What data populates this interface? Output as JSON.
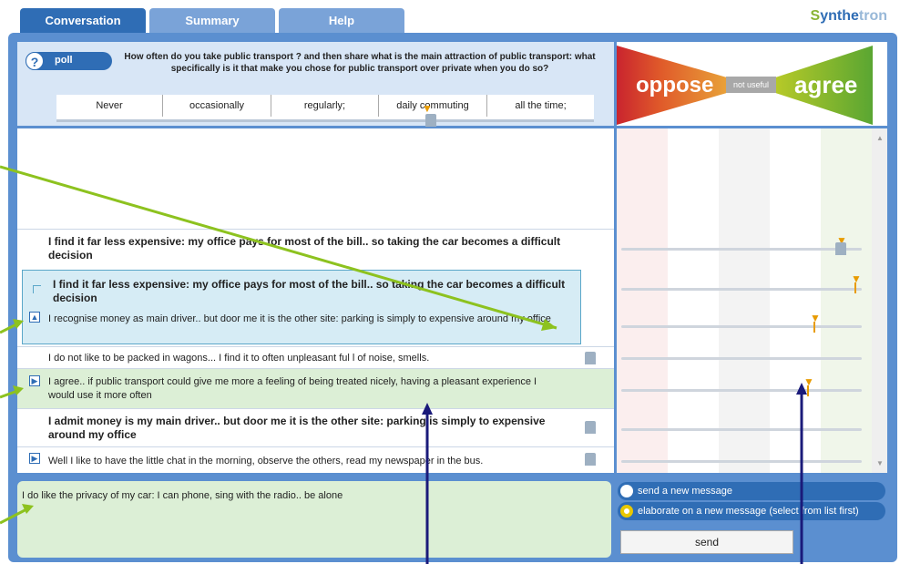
{
  "tabs": [
    {
      "label": "Conversation",
      "active": true
    },
    {
      "label": "Summary",
      "active": false
    },
    {
      "label": "Help",
      "active": false
    }
  ],
  "logo": {
    "part1": "S",
    "part2": "ynthe",
    "part3": "tron"
  },
  "poll": {
    "label": "poll",
    "question": "How often do you take public transport ? and then share what is the main attraction of public transport: what specifically is it that make you chose for public transport over private when you do so?",
    "options": [
      "Never",
      "occasionally",
      "regularly;",
      "daily commuting",
      "all the time;"
    ]
  },
  "scale": {
    "oppose": "oppose",
    "middle": "not useful",
    "agree": "agree"
  },
  "messages": [
    {
      "text": "I find it far less expensive: my office pays for most of the bill.. so taking the car becomes a difficult decision",
      "bold": true
    },
    {
      "text": "I find it far less expensive: my office pays for most of the bill.. so taking the car becomes a difficult decision",
      "bold": true
    },
    {
      "text": "I recognise money as main driver.. but door me it is the other site: parking is simply to expensive around my office",
      "bold": false
    },
    {
      "text": "I do not like to be packed in wagons... I find it to often unpleasant ful l of noise, smells.",
      "bold": false
    },
    {
      "text": "I agree.. if public transport could give me more a feeling of being treated nicely, having a pleasant experience I would use it more often",
      "bold": false
    },
    {
      "text": "I admit money is my main driver.. but door me it is the other site: parking is simply to expensive around my office",
      "bold": true
    },
    {
      "text": "Well I like to have the little chat in the morning, observe the others, read my newspaper in the bus.",
      "bold": false
    }
  ],
  "compose": {
    "text": "I do like the privacy of my car: I can phone, sing with the radio.. be alone"
  },
  "actions": {
    "new_message": "send a new message",
    "elaborate": "elaborate on a new message (select from list first)",
    "send": "send"
  },
  "colors": {
    "brand": "#2f6db5",
    "annotation_green": "#8dc21f",
    "annotation_navy": "#1a1a7a",
    "marker": "#e89b00"
  }
}
